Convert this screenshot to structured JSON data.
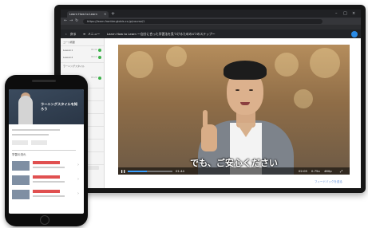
{
  "browser": {
    "tab_title": "Learn How to Learn",
    "address": "https://learn.frontier.globis.co.jp/course/1",
    "new_tab_symbol": "+",
    "tab_close_symbol": "×"
  },
  "app": {
    "back_label": "戻る",
    "menu_label": "メニュー",
    "course_title": "Learn How to Learn ～自分に合った学習法を見つけるための4つのステップ～"
  },
  "sidebar": {
    "section_label": "コース概要",
    "items": [
      {
        "label": "Lesson1",
        "time": "02:30"
      },
      {
        "label": "Lesson2",
        "time": "04:10"
      },
      {
        "label": "ラーニングスタイル",
        "time": ""
      },
      {
        "label": "Lesson3",
        "time": "03:20"
      }
    ]
  },
  "video": {
    "subtitle": "でも、ご安心ください",
    "current_time": "01:44",
    "duration": "02:05",
    "speed": "0.75x",
    "quality": "480p",
    "progress_fraction": 0.43
  },
  "feedback_link": "フィードバックを送る",
  "phone": {
    "video_title": "ラーニングスタイルを知ろう",
    "section_label": "学習の流れ"
  },
  "colors": {
    "accent_blue": "#2a8be6",
    "complete_green": "#3cb24a",
    "phone_accent_red": "#e05050"
  },
  "icons": [
    "back-icon",
    "menu-icon",
    "play-icon",
    "volume-icon",
    "fullscreen-icon",
    "settings-icon"
  ]
}
